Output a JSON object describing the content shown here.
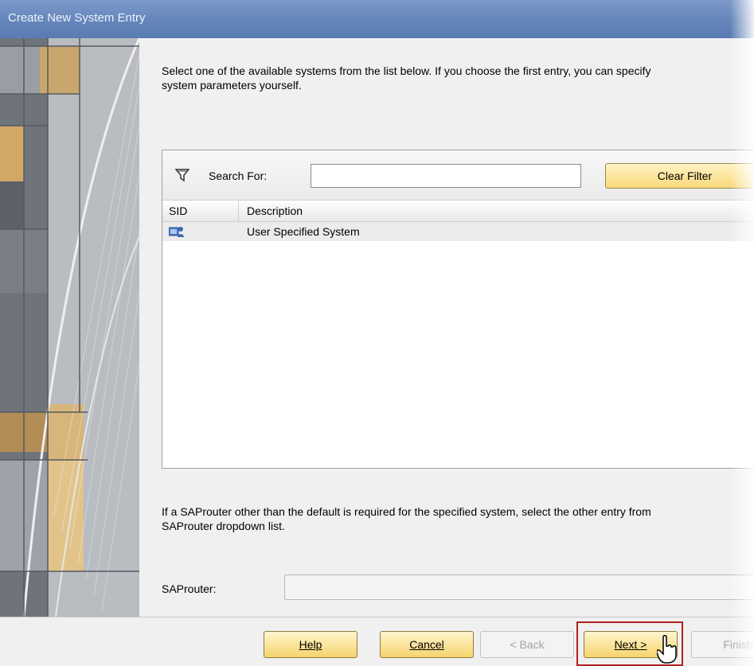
{
  "window": {
    "title": "Create New System Entry"
  },
  "intro": {
    "line1": "Select one of the available systems from the list below. If you choose the first entry, you can specify",
    "line2": "system parameters yourself."
  },
  "search": {
    "label": "Search For:",
    "value": "",
    "clear_label": "Clear Filter"
  },
  "table": {
    "columns": [
      "SID",
      "Description"
    ],
    "rows": [
      {
        "sid": "",
        "description": "User Specified System",
        "icon": "system-user-icon"
      }
    ]
  },
  "saprouter": {
    "text_line1": "If a SAProuter other than the default is required for the specified system, select the other entry from",
    "text_line2": "SAProuter dropdown list.",
    "label": "SAProuter:",
    "value": ""
  },
  "footer": {
    "help": "Help",
    "cancel": "Cancel",
    "back": "< Back",
    "next": "Next >",
    "finish": "Finish"
  },
  "colors": {
    "titlebar": "#6585bb",
    "button": "#f9d97a",
    "highlight": "#b21f1f"
  }
}
